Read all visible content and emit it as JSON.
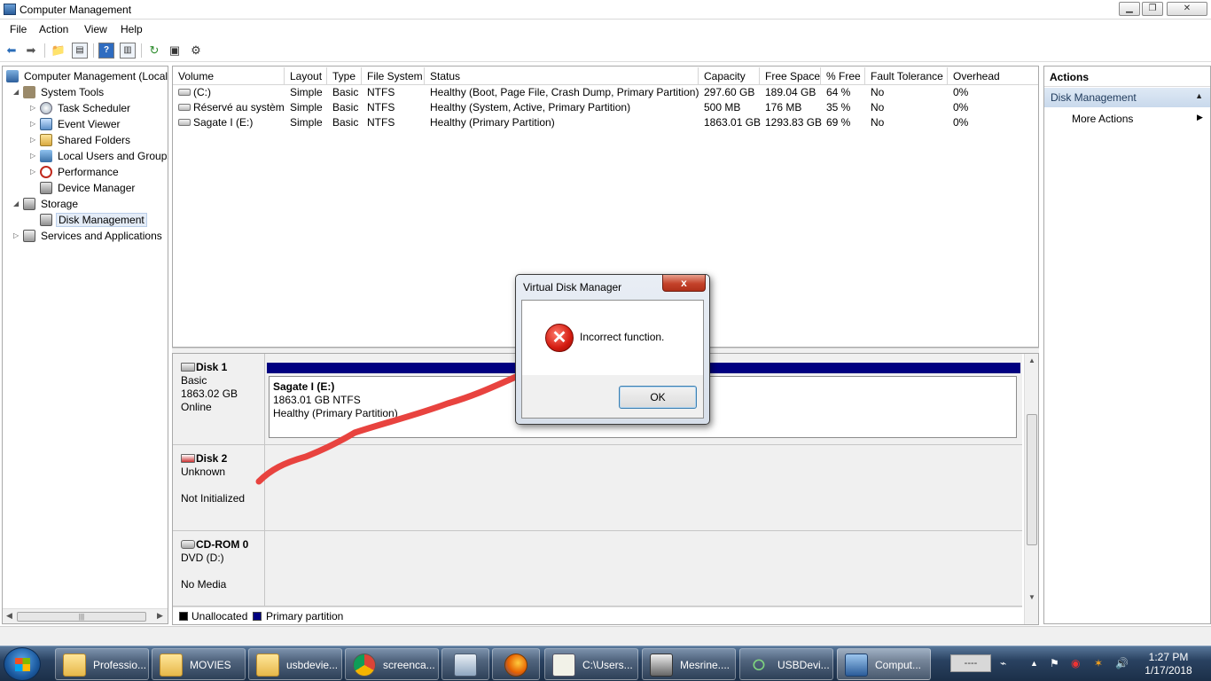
{
  "window": {
    "title": "Computer Management"
  },
  "menu": [
    "File",
    "Action",
    "View",
    "Help"
  ],
  "tree": {
    "root": "Computer Management (Local",
    "system_tools": "System Tools",
    "task_scheduler": "Task Scheduler",
    "event_viewer": "Event Viewer",
    "shared_folders": "Shared Folders",
    "local_users": "Local Users and Groups",
    "performance": "Performance",
    "device_manager": "Device Manager",
    "storage": "Storage",
    "disk_management": "Disk Management",
    "services": "Services and Applications"
  },
  "volumes": {
    "headers": [
      "Volume",
      "Layout",
      "Type",
      "File System",
      "Status",
      "Capacity",
      "Free Space",
      "% Free",
      "Fault Tolerance",
      "Overhead"
    ],
    "rows": [
      [
        "(C:)",
        "Simple",
        "Basic",
        "NTFS",
        "Healthy (Boot, Page File, Crash Dump, Primary Partition)",
        "297.60 GB",
        "189.04 GB",
        "64 %",
        "No",
        "0%"
      ],
      [
        "Réservé au système",
        "Simple",
        "Basic",
        "NTFS",
        "Healthy (System, Active, Primary Partition)",
        "500 MB",
        "176 MB",
        "35 %",
        "No",
        "0%"
      ],
      [
        "Sagate I (E:)",
        "Simple",
        "Basic",
        "NTFS",
        "Healthy (Primary Partition)",
        "1863.01 GB",
        "1293.83 GB",
        "69 %",
        "No",
        "0%"
      ]
    ]
  },
  "disks": {
    "disk1": {
      "name": "Disk 1",
      "type": "Basic",
      "size": "1863.02 GB",
      "state": "Online",
      "partition": {
        "name": "Sagate I  (E:)",
        "size": "1863.01 GB NTFS",
        "status": "Healthy (Primary Partition)"
      }
    },
    "disk2": {
      "name": "Disk 2",
      "type": "Unknown",
      "state": "Not Initialized"
    },
    "cdrom": {
      "name": "CD-ROM 0",
      "type": "DVD (D:)",
      "state": "No Media"
    }
  },
  "legend": {
    "unallocated": "Unallocated",
    "primary": "Primary partition"
  },
  "colors": {
    "unallocated": "#000000",
    "primary": "#000080",
    "annotation": "#e8433f"
  },
  "actions": {
    "header": "Actions",
    "section": "Disk Management",
    "more": "More Actions"
  },
  "dialog": {
    "title": "Virtual Disk Manager",
    "message": "Incorrect function.",
    "ok": "OK",
    "close": "x"
  },
  "taskbar": {
    "items": [
      "Professio...",
      "MOVIES",
      "usbdevie...",
      "screenca...",
      "",
      "",
      "C:\\Users...",
      "Mesrine....",
      "USBDevi...",
      "Comput..."
    ],
    "tray_box": "----",
    "time": "1:27 PM",
    "date": "1/17/2018"
  }
}
